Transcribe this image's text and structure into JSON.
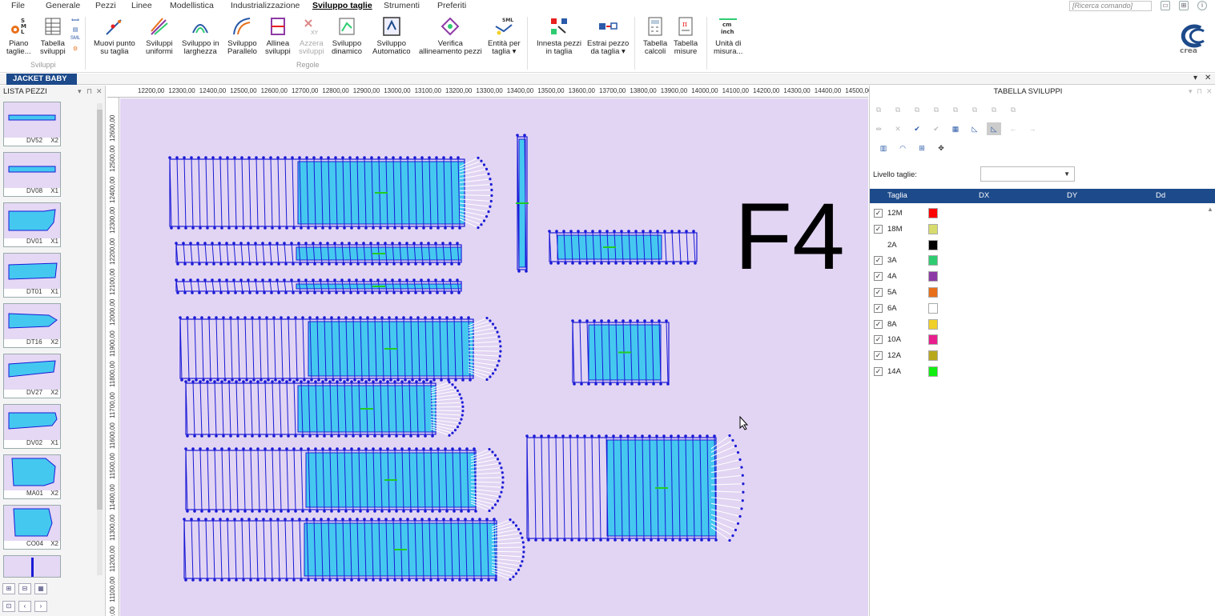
{
  "menu": {
    "items": [
      "File",
      "Generale",
      "Pezzi",
      "Linee",
      "Modellistica",
      "Industrializzazione",
      "Sviluppo taglie",
      "Strumenti",
      "Preferiti"
    ],
    "active": "Sviluppo taglie",
    "search_placeholder": "[Ricerca comando]"
  },
  "ribbon": {
    "buttons": [
      {
        "label1": "Piano",
        "label2": "taglie..."
      },
      {
        "label1": "Tabella",
        "label2": "sviluppi"
      },
      {
        "label1": "Muovi punto",
        "label2": "su taglia"
      },
      {
        "label1": "Sviluppi",
        "label2": "uniformi"
      },
      {
        "label1": "Sviluppo in",
        "label2": "larghezza"
      },
      {
        "label1": "Sviluppo",
        "label2": "Parallelo"
      },
      {
        "label1": "Allinea",
        "label2": "sviluppi"
      },
      {
        "label1": "Azzera",
        "label2": "sviluppi"
      },
      {
        "label1": "Sviluppo",
        "label2": "dinamico"
      },
      {
        "label1": "Sviluppo",
        "label2": "Automatico"
      },
      {
        "label1": "Verifica",
        "label2": "allineamento pezzi"
      },
      {
        "label1": "Entità per",
        "label2": "taglia ▾"
      },
      {
        "label1": "Innesta pezzi",
        "label2": "in taglia"
      },
      {
        "label1": "Estrai pezzo",
        "label2": "da taglia ▾"
      },
      {
        "label1": "Tabella",
        "label2": "calcoli"
      },
      {
        "label1": "Tabella",
        "label2": "misure"
      },
      {
        "label1": "Unità di",
        "label2": "misura..."
      }
    ],
    "groups": [
      "Sviluppi",
      "Regole"
    ],
    "small_icon_texts": {
      "sml": "SML",
      "sml_icon": "SML",
      "cm": "cm",
      "inch": "inch"
    },
    "logo_text": "crea"
  },
  "document_tab": "JACKET BABY",
  "left_panel": {
    "title": "LISTA PEZZI",
    "pieces": [
      {
        "code": "DV52",
        "qty": "X2"
      },
      {
        "code": "DV08",
        "qty": "X1"
      },
      {
        "code": "DV01",
        "qty": "X1"
      },
      {
        "code": "DT01",
        "qty": "X1"
      },
      {
        "code": "DT16",
        "qty": "X2"
      },
      {
        "code": "DV27",
        "qty": "X2"
      },
      {
        "code": "DV02",
        "qty": "X1"
      },
      {
        "code": "MA01",
        "qty": "X2"
      },
      {
        "code": "CO04",
        "qty": "X2"
      }
    ]
  },
  "canvas": {
    "ruler_top": [
      "12200,00",
      "12300,00",
      "12400,00",
      "12500,00",
      "12600,00",
      "12700,00",
      "12800,00",
      "12900,00",
      "13000,00",
      "13100,00",
      "13200,00",
      "13300,00",
      "13400,00",
      "13500,00",
      "13600,00",
      "13700,00",
      "13800,00",
      "13900,00",
      "14000,00",
      "14100,00",
      "14200,00",
      "14300,00",
      "14400,00",
      "14500,00"
    ],
    "ruler_left": [
      "12600,00",
      "12500,00",
      "12400,00",
      "12300,00",
      "12200,00",
      "12100,00",
      "12000,00",
      "11900,00",
      "11800,00",
      "11700,00",
      "11600,00",
      "11500,00",
      "11400,00",
      "11300,00",
      "11200,00",
      "11100,00",
      "11000,00"
    ],
    "big_label": "F4"
  },
  "right_panel": {
    "title": "TABELLA SVILUPPI",
    "level_label": "Livello taglie:",
    "level_value": "",
    "columns": [
      "Taglia",
      "DX",
      "DY",
      "Dd"
    ],
    "sizes": [
      {
        "name": "12M",
        "checked": true,
        "color": "#ff0000"
      },
      {
        "name": "18M",
        "checked": true,
        "color": "#d8dc6c"
      },
      {
        "name": "2A",
        "checked": false,
        "color": "#000000"
      },
      {
        "name": "3A",
        "checked": true,
        "color": "#2ecc71"
      },
      {
        "name": "4A",
        "checked": true,
        "color": "#8e3aa6"
      },
      {
        "name": "5A",
        "checked": true,
        "color": "#e8701a"
      },
      {
        "name": "6A",
        "checked": true,
        "color": "#ffffff"
      },
      {
        "name": "8A",
        "checked": true,
        "color": "#f2d02a"
      },
      {
        "name": "10A",
        "checked": true,
        "color": "#e81f8c"
      },
      {
        "name": "12A",
        "checked": true,
        "color": "#b9a81c"
      },
      {
        "name": "14A",
        "checked": true,
        "color": "#11ee11"
      }
    ]
  },
  "colors": {
    "accent_blue": "#1d4a8a",
    "canvas_bg": "#e2d5f3",
    "piece_fill": "#45c8f0",
    "piece_line": "#1a1ad6",
    "grade_point": "#22cc22"
  }
}
